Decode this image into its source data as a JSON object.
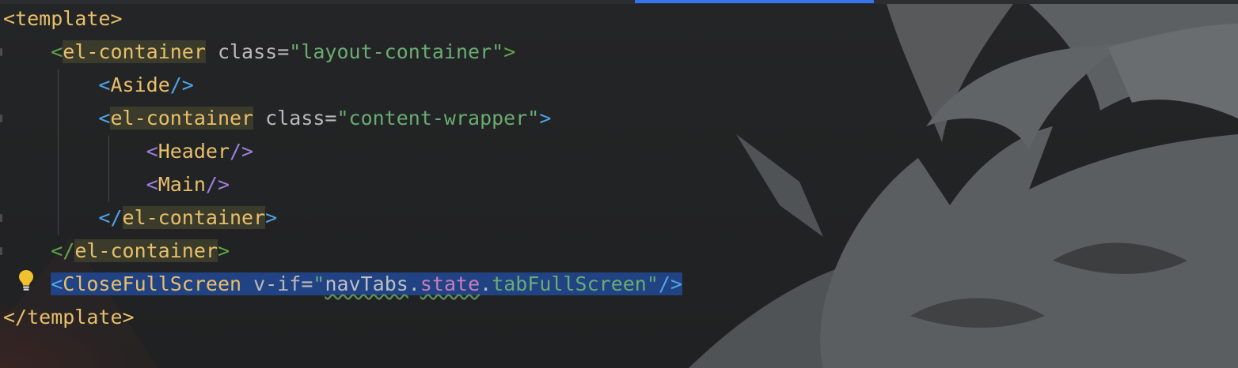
{
  "editor": {
    "lines": [
      {
        "parts": {
          "open": "<",
          "name": "template",
          "close": ">"
        }
      },
      {
        "parts": {
          "indent": "    ",
          "open": "<",
          "name": "el-container",
          "attr": " class=",
          "value": "\"layout-container\"",
          "close": ">"
        }
      },
      {
        "parts": {
          "indent": "        ",
          "open": "<",
          "name": "Aside",
          "close": "/>"
        }
      },
      {
        "parts": {
          "indent": "        ",
          "open": "<",
          "name": "el-container",
          "attr": " class=",
          "value": "\"content-wrapper\"",
          "close": ">"
        }
      },
      {
        "parts": {
          "indent": "            ",
          "open": "<",
          "name": "Header",
          "close": "/>"
        }
      },
      {
        "parts": {
          "indent": "            ",
          "open": "<",
          "name": "Main",
          "close": "/>"
        }
      },
      {
        "parts": {
          "indent": "        ",
          "open": "</",
          "name": "el-container",
          "close": ">"
        }
      },
      {
        "parts": {
          "indent": "    ",
          "open": "</",
          "name": "el-container",
          "close": ">"
        }
      },
      {
        "parts": {
          "indent": "    ",
          "open": "<",
          "name": "CloseFullScreen",
          "attr": " v-if=",
          "q1": "\"",
          "obj": "navTabs",
          "dot1": ".",
          "member": "state",
          "dot2": ".",
          "prop": "tabFullScreen",
          "q2": "\"",
          "close": "/>"
        }
      },
      {
        "parts": {
          "open": "</",
          "name": "template",
          "close": ">"
        }
      }
    ]
  },
  "gutter": {
    "intention_icon": "lightbulb-icon"
  },
  "colors": {
    "background": "#232425",
    "tag": "#e8bf6a",
    "string": "#6aab73",
    "attribute": "#bababa",
    "selection": "#214283",
    "component_bracket": "#4ea4e8",
    "element_bracket": "#5fa84a",
    "active_tab": "#3574f0"
  }
}
